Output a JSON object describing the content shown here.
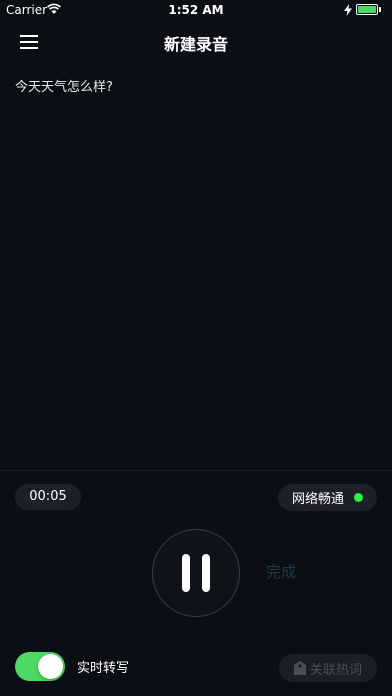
{
  "status_bar": {
    "carrier": "Carrier",
    "time": "1:52 AM",
    "battery_level": 1.0
  },
  "nav": {
    "title": "新建录音",
    "menu_icon": "hamburger-menu-icon"
  },
  "transcript": {
    "text": "今天天气怎么样?"
  },
  "controls": {
    "timer": "00:05",
    "network_status": "网络畅通",
    "network_status_color": "#2ef04a",
    "pause_icon": "pause-icon",
    "done_label": "完成",
    "realtime_label": "实时转写",
    "realtime_enabled": true,
    "toggle_color": "#4cd964",
    "hotwords_label": "关联热词",
    "hotwords_icon": "tag-icon"
  }
}
